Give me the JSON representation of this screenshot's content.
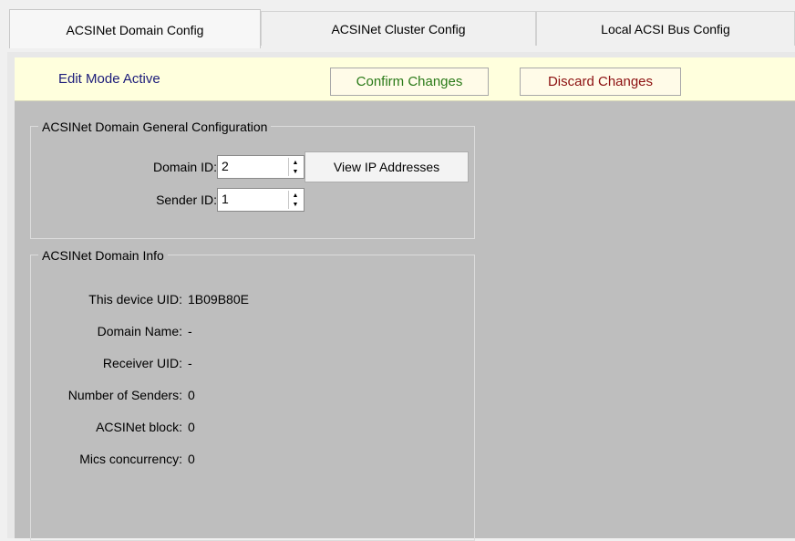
{
  "tabs": [
    {
      "label": "ACSINet Domain Config",
      "active": true
    },
    {
      "label": "ACSINet Cluster Config",
      "active": false
    },
    {
      "label": "Local ACSI Bus Config",
      "active": false
    }
  ],
  "edit_bar": {
    "status": "Edit Mode Active",
    "confirm_label": "Confirm Changes",
    "discard_label": "Discard Changes"
  },
  "general": {
    "title": "ACSINet Domain General Configuration",
    "domain_id_label": "Domain ID:",
    "domain_id_value": "2",
    "sender_id_label": "Sender ID:",
    "sender_id_value": "1",
    "view_ip_label": "View IP Addresses"
  },
  "info": {
    "title": "ACSINet Domain Info",
    "rows": [
      {
        "label": "This device UID:",
        "value": "1B09B80E"
      },
      {
        "label": "Domain Name:",
        "value": "-"
      },
      {
        "label": "Receiver UID:",
        "value": "-"
      },
      {
        "label": "Number of Senders:",
        "value": "0"
      },
      {
        "label": "ACSINet block:",
        "value": "0"
      },
      {
        "label": "Mics concurrency:",
        "value": "0"
      }
    ]
  },
  "colors": {
    "panel_bg": "#bebebe",
    "edit_bar_bg": "#ffffdd",
    "confirm_text": "#2a7a18",
    "discard_text": "#8c1010",
    "edit_status_text": "#1c1c7a"
  }
}
